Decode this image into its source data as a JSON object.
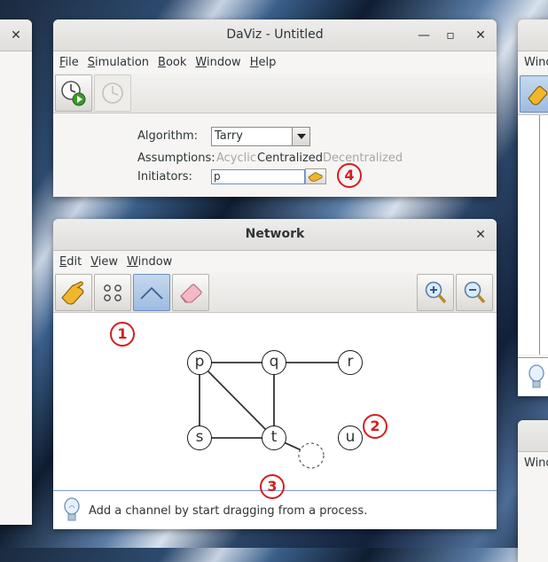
{
  "main_window": {
    "title": "DaViz - Untitled",
    "menu": [
      "File",
      "Simulation",
      "Book",
      "Window",
      "Help"
    ],
    "menu_mnemonics": [
      "F",
      "S",
      "B",
      "W",
      "H"
    ],
    "tools": [
      {
        "icon": "simulation-clock-play-icon",
        "enabled": true
      },
      {
        "icon": "simulation-clock-icon",
        "enabled": false
      }
    ],
    "algorithm_label": "Algorithm:",
    "algorithm_value": "Tarry",
    "assumptions_label": "Assumptions:",
    "assumptions": [
      {
        "text": "Acyclic",
        "active": false
      },
      {
        "text": "Centralized",
        "active": true
      },
      {
        "text": "Decentralized",
        "active": false
      }
    ],
    "initiators_label": "Initiators:",
    "initiators_value": "p"
  },
  "network_window": {
    "title": "Network",
    "menu": [
      "Edit",
      "View",
      "Window"
    ],
    "menu_mnemonics": [
      "E",
      "V",
      "W"
    ],
    "tools": [
      {
        "icon": "pointer-hand-icon",
        "active": false
      },
      {
        "icon": "process-dots-icon",
        "active": false
      },
      {
        "icon": "channel-line-icon",
        "active": true
      },
      {
        "icon": "eraser-icon",
        "active": false
      }
    ],
    "zoom_tools": [
      "zoom-in-icon",
      "zoom-out-icon"
    ],
    "nodes": [
      {
        "id": "p",
        "label": "p"
      },
      {
        "id": "q",
        "label": "q"
      },
      {
        "id": "r",
        "label": "r"
      },
      {
        "id": "s",
        "label": "s"
      },
      {
        "id": "t",
        "label": "t"
      },
      {
        "id": "u",
        "label": "u"
      }
    ],
    "edges": [
      [
        "p",
        "q"
      ],
      [
        "q",
        "r"
      ],
      [
        "p",
        "s"
      ],
      [
        "p",
        "t"
      ],
      [
        "q",
        "t"
      ],
      [
        "s",
        "t"
      ],
      [
        "t",
        "ghost"
      ]
    ],
    "status_text": "Add a channel by start dragging from a process."
  },
  "markers": [
    "1",
    "2",
    "3",
    "4"
  ],
  "bg_windows": {
    "right_menu_label": "Wind",
    "right_lower_menu_label": "Wind"
  },
  "colors": {
    "marker": "#d41f1f",
    "active_tool": "#9dbbe0",
    "status_border": "#7a9cc6"
  }
}
